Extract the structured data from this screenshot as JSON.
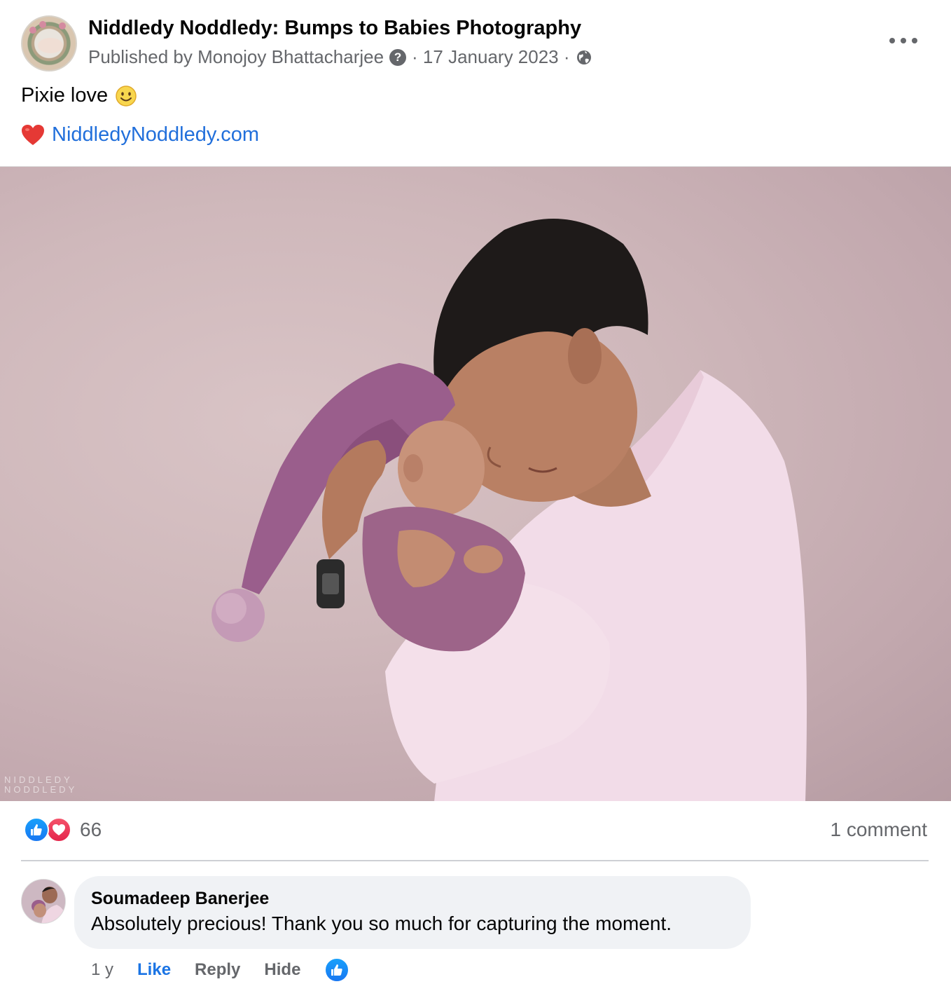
{
  "post": {
    "page_name": "Niddledy Noddledy: Bumps to Babies Photography",
    "published_by": "Published by Monojoy Bhattacharjee",
    "date": "· 17 January 2023 ·",
    "help_glyph": "?",
    "text": "Pixie love",
    "link": "NiddledyNoddledy.com",
    "watermark_line1": "NIDDLEDY",
    "watermark_line2": "NODDLEDY"
  },
  "reactions": {
    "count": "66",
    "types": [
      "like-icon",
      "love-icon"
    ],
    "comments": "1 comment"
  },
  "comment": {
    "author": "Soumadeep Banerjee",
    "text": "Absolutely precious! Thank you so much for capturing the moment.",
    "age": "1 y",
    "like_label": "Like",
    "reply_label": "Reply",
    "hide_label": "Hide"
  },
  "colors": {
    "link": "#216fdb",
    "like_blue": "#1877f2",
    "love_red": "#e4254b",
    "secondary_text": "#65676b",
    "bubble_bg": "#f0f2f5"
  }
}
